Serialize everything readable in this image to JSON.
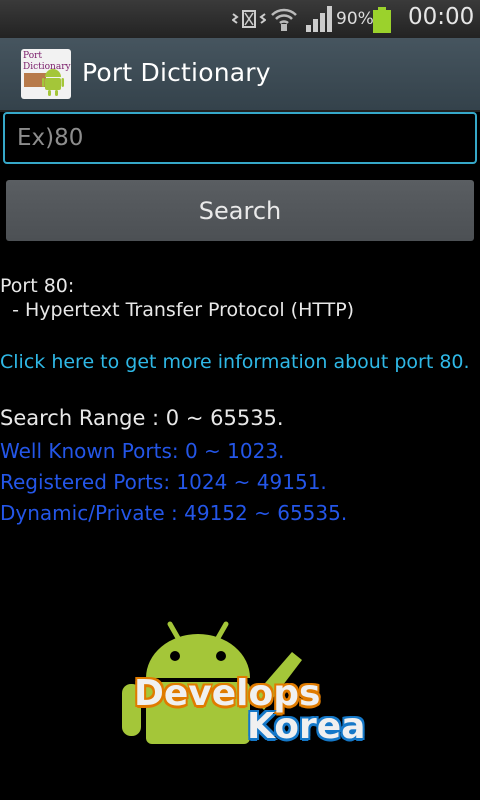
{
  "status_bar": {
    "battery_percent": "90%",
    "time": "00:00",
    "icons": [
      "vibrate-icon",
      "wifi-icon",
      "signal-icon",
      "battery-icon"
    ],
    "battery_level": 0.9
  },
  "action_bar": {
    "title": "Port Dictionary",
    "logo_text": "Port Dictionary"
  },
  "search": {
    "placeholder": "Ex)80",
    "value": "",
    "button_label": "Search"
  },
  "result": {
    "port_line": "Port 80:",
    "description_line": "  - Hypertext Transfer Protocol (HTTP)",
    "more_info_link": "Click here to get more information about port 80."
  },
  "ranges": {
    "search_range": "Search Range : 0 ~ 65535.",
    "well_known": "Well Known Ports: 0 ~ 1023.",
    "registered": "Registered Ports: 1024 ~ 49151.",
    "dynamic": "Dynamic/Private : 49152 ~ 65535."
  },
  "banner": {
    "line1": "Develops",
    "line2": "Korea"
  },
  "colors": {
    "accent": "#36a8c9",
    "link": "#2fb8e6",
    "range_blue": "#2456e8",
    "android_green": "#a4c639"
  }
}
